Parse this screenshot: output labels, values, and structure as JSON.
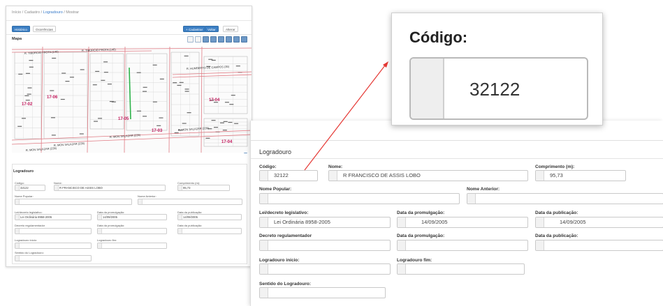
{
  "thumb": {
    "breadcrumb": [
      "Início",
      "Cadastro",
      "Logradouro",
      "Mostrar"
    ],
    "separator": "/",
    "btn_historico": "Histórico",
    "btn_ocorrencias": "Ocorrências",
    "btn_cadastrar": "+ Cadastrar",
    "btn_voltar": "Voltar",
    "btn_alterar": "Alterar",
    "map_label": "Mapa",
    "street_labels": [
      "R. TIBÚRCIO FROTA (140)",
      "R. TIBÚRCIO FROTA (140)",
      "R. HUMBERTO DE CAMPOS (35)",
      "R. MON SALAZAR (235)",
      "R. MON SALAZAR (235)",
      "R. MON SALAZAR (235)",
      "R. MON SALAZAR (235)"
    ],
    "block_labels": [
      "17-06",
      "17-04",
      "17-05",
      "17-02",
      "17-03",
      "17-04"
    ],
    "panel_title": "Logradouro",
    "labels": {
      "codigo": "Código:",
      "nome": "Nome:",
      "comprimento": "Comprimento (m):",
      "nome_popular": "Nome Popular:",
      "nome_anterior": "Nome Anterior:",
      "lei": "Lei/decreto legislativo:",
      "data_prom": "Data da promulgação:",
      "data_pub": "Data da publicação:",
      "decreto": "Decreto regulamentador",
      "data_prom2": "Data da promulgação:",
      "data_pub2": "Data da publicação:",
      "inicio": "Logradouro início:",
      "fim": "Logradouro fim:",
      "sentido": "Sentido do Logradouro:"
    },
    "values": {
      "codigo": "32122",
      "nome": "R FRANCISCO DE ASSIS LOBO",
      "comprimento": "95,73",
      "lei": "Lei Ordinária 8958-2005",
      "data_prom": "14/09/2005",
      "data_pub": "14/09/2005"
    }
  },
  "form": {
    "title": "Logradouro",
    "labels": {
      "codigo": "Código:",
      "nome": "Nome:",
      "comprimento": "Comprimento (m):",
      "nome_popular": "Nome Popular:",
      "nome_anterior": "Nome Anterior:",
      "lei": "Lei/decreto legislativo:",
      "data_prom": "Data da promulgação:",
      "data_pub": "Data da publicação:",
      "decreto": "Decreto regulamentador",
      "data_prom2": "Data da promulgação:",
      "data_pub2": "Data da publicação:",
      "inicio": "Logradouro início:",
      "fim": "Logradouro fim:",
      "sentido": "Sentido do Logradouro:"
    },
    "values": {
      "codigo": "32122",
      "nome": "R FRANCISCO DE ASSIS LOBO",
      "comprimento": "95,73",
      "lei": "Lei Ordinária 8958-2005",
      "data_prom": "14/09/2005",
      "data_pub": "14/09/2005"
    }
  },
  "zoom": {
    "label": "Código:",
    "value": "32122"
  },
  "colors": {
    "accent": "#3c7fc4",
    "street_line": "#e07b84",
    "highlight_street": "#2db34a",
    "arrow": "#e53935"
  }
}
